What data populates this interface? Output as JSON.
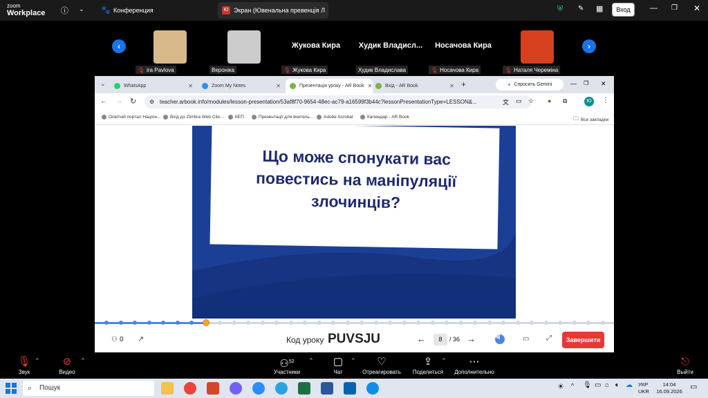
{
  "zoom": {
    "logo_line1": "zoom",
    "logo_line2": "Workplace",
    "conference_label": "Конференция",
    "share_title": "Экран (Ювенальна превенція Л",
    "share_avatar": "Ю",
    "signin_button": "Вход"
  },
  "participants": [
    {
      "label": "ira Pavlova",
      "big": "",
      "muted": true,
      "thumb": "#d8b98a"
    },
    {
      "label": "Вероніка",
      "big": "",
      "muted": false,
      "thumb": "#cccccc"
    },
    {
      "label": "Жукова Кира",
      "big": "Жукова Кира",
      "muted": true,
      "thumb": ""
    },
    {
      "label": "Худик Владислава",
      "big": "Худик  Владисл...",
      "muted": false,
      "thumb": ""
    },
    {
      "label": "Носачова Кира",
      "big": "Носачова Кира",
      "muted": true,
      "thumb": ""
    },
    {
      "label": "Наталя Череміна",
      "big": "",
      "muted": true,
      "thumb": "#d6401f"
    }
  ],
  "browser": {
    "tabs": [
      {
        "label": "WhatsApp",
        "icon": "#25d366"
      },
      {
        "label": "Zoom My Notes",
        "icon": "#2d8cff"
      },
      {
        "label": "Презентація уроку - AR Book",
        "icon": "#7cb342"
      },
      {
        "label": "Вхід - AR Book",
        "icon": "#7cb342"
      }
    ],
    "gemini": "Спросить Gemini",
    "url": "teacher.arbook.info/modules/lesson-presentation/53af8f70-9654-48ec-ac79-a16599f3b44c?lessonPresentationType=LESSON&...",
    "profile": "Ю",
    "bookmarks": [
      "Освітній портал Націон...",
      "Вхід до Zimbra Web Clie...",
      "КЕП",
      "Презентації для вчитель...",
      "Adobe Acrobat",
      "Календар - AR Book"
    ],
    "all_bookmarks": "Все закладки"
  },
  "slide": {
    "question": "Що може спонукати вас повестись на маніпуляції злочинців?",
    "current_page": 8,
    "total_pages": 36,
    "total_label": "/ 36",
    "current_label": "8",
    "lesson_code_label": "Код уроку",
    "lesson_code": "PUVSJU",
    "viewers": "0",
    "finish_button": "Завершити"
  },
  "controls": {
    "audio": "Звук",
    "video": "Видео",
    "participants": "Участники",
    "participants_count": "52",
    "chat": "Чат",
    "react": "Отреагировать",
    "share": "Поделиться",
    "more": "Дополнительно",
    "leave": "Выйти"
  },
  "taskbar": {
    "search_placeholder": "Пошук",
    "lang1": "УКР",
    "lang2": "UKR",
    "time": "14:04",
    "date": "16.09.2026"
  },
  "colors": {
    "slide_blue": "#1c3f96",
    "accent_blue": "#1a73e8",
    "finish_red": "#e53935"
  }
}
